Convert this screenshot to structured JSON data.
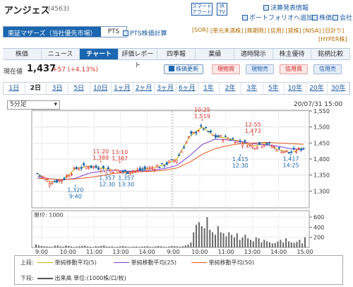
{
  "header": {
    "title": "アンジェス",
    "code": "(4563)",
    "smart_alert": "スマート\nアラート",
    "ir_tv": "IR\nTV",
    "links": [
      "決算発表情報",
      "ポートフォリオへ追加",
      "株価",
      "会社"
    ],
    "market_tabs": [
      "東証マザーズ（当社優先市場）",
      "PTS"
    ],
    "pts_link": "PTS株価計算",
    "tags_line1": "[SOR]",
    "tags_line1b": "[単元未満株] [無期限]  [信用] [貸株] [NISA] [日計り]",
    "tags_line2": "[HYPER株]"
  },
  "nav": [
    "株価",
    "ニュース",
    "チャート",
    "評価レポート",
    "四季報",
    "業績",
    "適時開示",
    "株主優待",
    "銘柄比較"
  ],
  "nav_active": 2,
  "quote": {
    "label": "現在値",
    "price": "1,437",
    "change": "+57 (+4.13%)",
    "update_label": "株価更新",
    "buttons": [
      "現物買",
      "現物売",
      "信用買",
      "信用売"
    ]
  },
  "periods": [
    "1日",
    "2日",
    "3日",
    "5日",
    "10日",
    "1ヶ月",
    "2ヶ月",
    "3ヶ月",
    "6ヶ月",
    "1年",
    "2年",
    "3年",
    "5年",
    "10年",
    "20年",
    "30年"
  ],
  "period_selected": 1,
  "interval": "5分足",
  "datetime": "20/07/31 15:00",
  "colors": {
    "accent": "#1a66b0",
    "up": "#e0322a",
    "down": "#1a66b0"
  },
  "chart_data": {
    "type": "line",
    "x": [
      "9:00",
      "9:30",
      "10:00",
      "10:30",
      "11:00",
      "11:30",
      "13:00",
      "13:30",
      "14:00",
      "14:30",
      "15:00",
      "9:00",
      "9:30",
      "10:00",
      "10:30",
      "11:00",
      "11:30",
      "13:00",
      "13:30",
      "14:00",
      "14:30",
      "15:00"
    ],
    "x_ticks": [
      "9:00\n7/30",
      "10:00",
      "11:00",
      "13:00",
      "14:00",
      "9:00\n7/31",
      "10:00",
      "11:00",
      "13:00",
      "14:00",
      "15:00"
    ],
    "series": [
      {
        "name": "単純移動平均(5)",
        "values": [
          1355,
          1328,
          1335,
          1370,
          1378,
          1372,
          1365,
          1360,
          1365,
          1372,
          1382,
          1400,
          1470,
          1500,
          1470,
          1465,
          1455,
          1440,
          1450,
          1430,
          1420,
          1435
        ]
      },
      {
        "name": "単純移動平均(25)",
        "values": [
          1345,
          1338,
          1335,
          1340,
          1355,
          1362,
          1365,
          1362,
          1363,
          1365,
          1370,
          1380,
          1410,
          1445,
          1462,
          1460,
          1455,
          1448,
          1445,
          1440,
          1432,
          1430
        ]
      },
      {
        "name": "単純移動平均(50)",
        "values": [
          1340,
          1338,
          1336,
          1338,
          1342,
          1348,
          1355,
          1358,
          1360,
          1362,
          1365,
          1372,
          1390,
          1415,
          1432,
          1442,
          1448,
          1450,
          1452,
          1450,
          1448,
          1446
        ]
      }
    ],
    "annotations": [
      {
        "time": "9:40",
        "value": 1320
      },
      {
        "time": "11:20",
        "value": 1389
      },
      {
        "time": "12:30",
        "value": 1357
      },
      {
        "time": "13:10",
        "value": 1387
      },
      {
        "time": "13:30",
        "value": 1357
      },
      {
        "time": "10:25",
        "value": 1519
      },
      {
        "time": "12:30",
        "value": 1415
      },
      {
        "time": "12:55",
        "value": 1473
      },
      {
        "time": "14:25",
        "value": 1417
      }
    ],
    "ylim": [
      1250,
      1550
    ],
    "y_ticks": [
      "1,550",
      "1,500",
      "1,450",
      "1,400",
      "1,350",
      "1,300"
    ],
    "volume_label": "単位: 1000",
    "volume_ylim": [
      0,
      700
    ],
    "volume_ticks": [
      "600",
      "400",
      "200"
    ],
    "volume": [
      60,
      40,
      30,
      20,
      20,
      15,
      10,
      35,
      40,
      20,
      15,
      40,
      30,
      20,
      10,
      15,
      25,
      30,
      35,
      20,
      15,
      10,
      25,
      20,
      30,
      40,
      20,
      15,
      20,
      10,
      15,
      20,
      30,
      20,
      10,
      10,
      15,
      20,
      10,
      15,
      20,
      25,
      15,
      10,
      20,
      30,
      20,
      15,
      10,
      20,
      30,
      25,
      20,
      15,
      25,
      40,
      60,
      100,
      300,
      450,
      500,
      420,
      380,
      600,
      350,
      300,
      250,
      420,
      300,
      280,
      220,
      300,
      250,
      200,
      280,
      150,
      200,
      250,
      180,
      150,
      120,
      200,
      180,
      100,
      150,
      120,
      100,
      80,
      90,
      120,
      150,
      100,
      180,
      120,
      100,
      90,
      110,
      150,
      80,
      200
    ]
  },
  "legend": {
    "upper_label": "上段:",
    "lower_label": "下段:",
    "items": [
      "単純移動平均(5)",
      "単純移動平均(25)",
      "単純移動平均(50)"
    ],
    "volume_item": "出来高 単位:(1000株/口/枚)"
  }
}
